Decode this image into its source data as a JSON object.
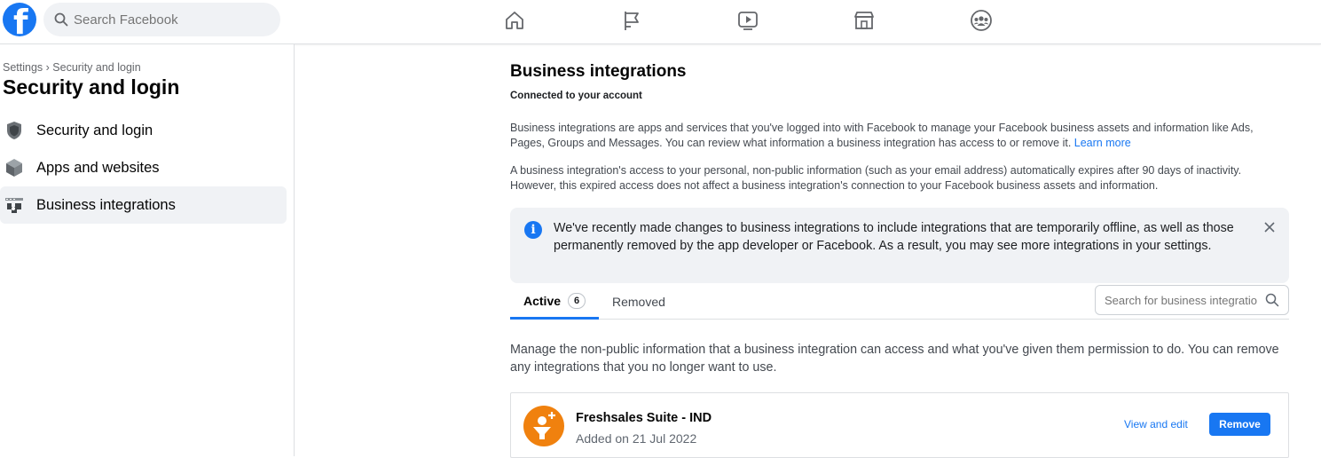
{
  "topbar": {
    "logo_letter": "f",
    "search_placeholder": "Search Facebook",
    "nav_icons": [
      "home-icon",
      "flag-icon",
      "video-icon",
      "marketplace-icon",
      "groups-icon"
    ]
  },
  "sidebar": {
    "breadcrumb": "Settings › Security and login",
    "title": "Security and login",
    "items": [
      {
        "label": "Security and login",
        "icon": "shield-icon"
      },
      {
        "label": "Apps and websites",
        "icon": "cube-icon"
      },
      {
        "label": "Business integrations",
        "icon": "business-integrations-icon"
      }
    ]
  },
  "main": {
    "title": "Business integrations",
    "subtitle": "Connected to your account",
    "para1": "Business integrations are apps and services that you've logged into with Facebook to manage your Facebook business assets and information like Ads, Pages, Groups and Messages. You can review what information a business integration has access to or remove it.",
    "learn_more": "Learn more",
    "para2": "A business integration's access to your personal, non-public information (such as your email address) automatically expires after 90 days of inactivity. However, this expired access does not affect a business integration's connection to your Facebook business assets and information.",
    "notice": "We've recently made changes to business integrations to include integrations that are temporarily offline, as well as those permanently removed by the app developer or Facebook. As a result, you may see more integrations in your settings.",
    "tabs": {
      "active_label": "Active",
      "active_count": "6",
      "removed_label": "Removed"
    },
    "tab_search_placeholder": "Search for business integrations",
    "manage_text": "Manage the non-public information that a business integration can access and what you've given them permission to do. You can remove any integrations that you no longer want to use.",
    "integration": {
      "name": "Freshsales Suite - IND",
      "added": "Added on 21 Jul 2022",
      "view_edit": "View and edit",
      "remove": "Remove"
    }
  },
  "colors": {
    "accent": "#1877f2",
    "app_icon": "#f0810e"
  }
}
